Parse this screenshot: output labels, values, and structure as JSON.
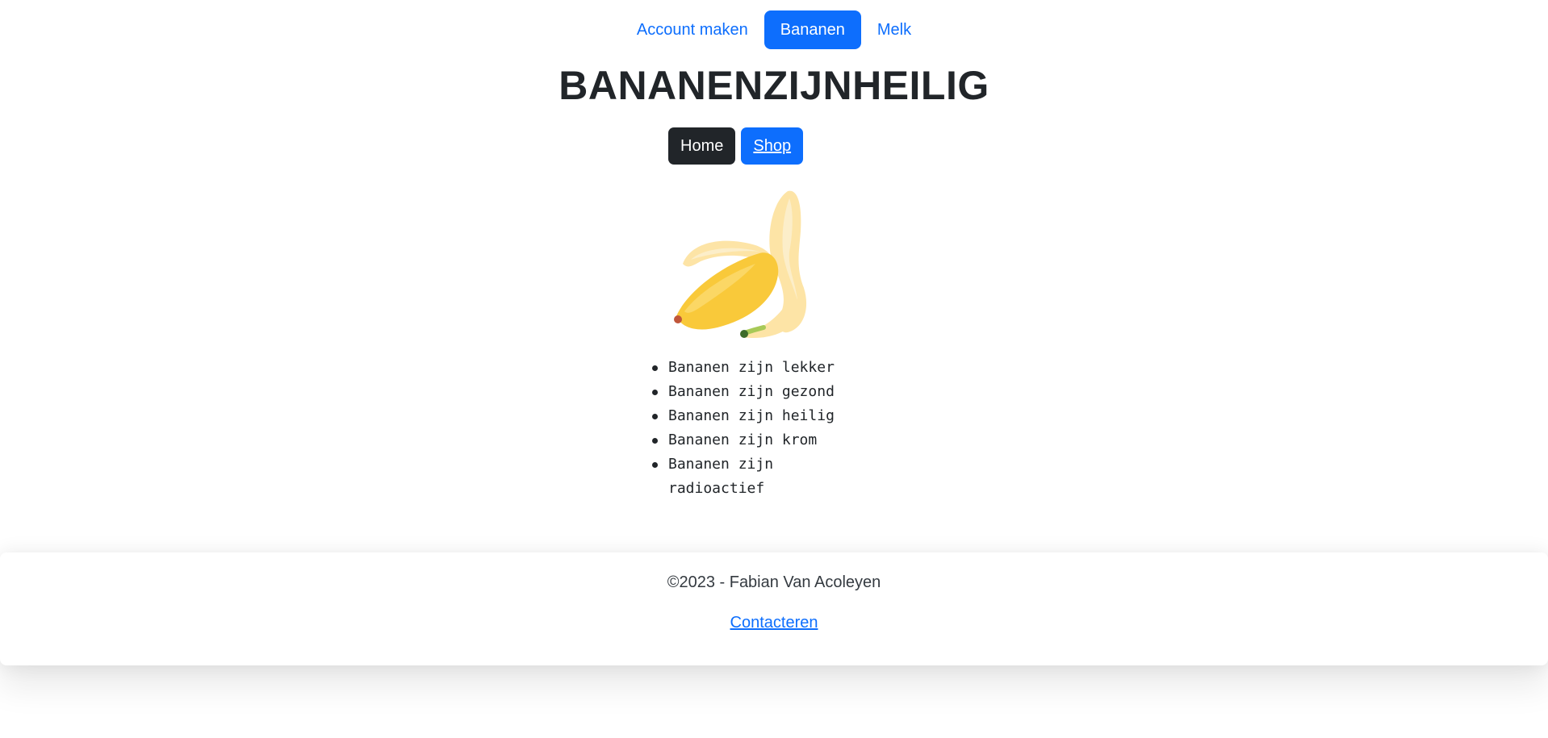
{
  "top_nav": {
    "items": [
      {
        "label": "Account maken"
      },
      {
        "label": "Bananen"
      },
      {
        "label": "Melk"
      }
    ]
  },
  "site_title": "BANANENZIJNHEILIG",
  "sub_nav": {
    "home_label": "Home",
    "shop_label": "Shop"
  },
  "banana_image": {
    "icon": "peeled-banana-icon"
  },
  "facts": [
    "Bananen zijn lekker",
    "Bananen zijn gezond",
    "Bananen zijn heilig",
    "Bananen zijn krom",
    "Bananen zijn radioactief"
  ],
  "footer": {
    "copyright": "©2023 - Fabian Van Acoleyen",
    "contact_label": "Contacteren"
  },
  "colors": {
    "primary": "#0d6efd",
    "dark": "#212529",
    "banana_yellow": "#f9c93a",
    "banana_peel": "#fde6b0"
  }
}
